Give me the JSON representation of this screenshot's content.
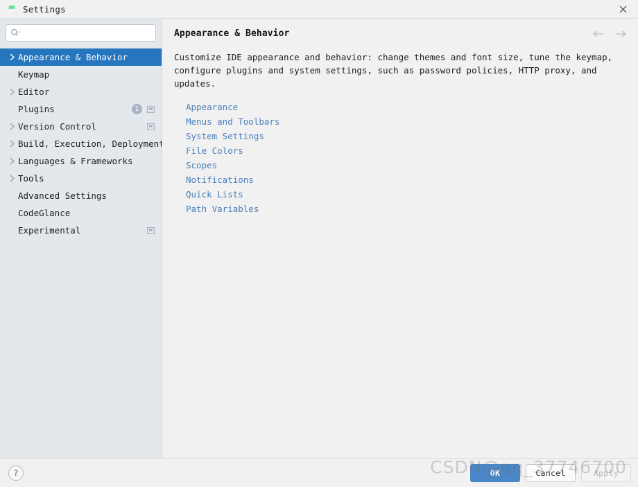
{
  "window": {
    "title": "Settings",
    "app_icon": "android-robot-icon",
    "close_icon": "close-icon"
  },
  "search": {
    "value": "",
    "placeholder": "",
    "icon": "search-icon"
  },
  "sidebar": {
    "items": [
      {
        "label": "Appearance & Behavior",
        "expandable": true,
        "selected": true,
        "badge": null,
        "panel_icon": false
      },
      {
        "label": "Keymap",
        "expandable": false,
        "selected": false,
        "badge": null,
        "panel_icon": false
      },
      {
        "label": "Editor",
        "expandable": true,
        "selected": false,
        "badge": null,
        "panel_icon": false
      },
      {
        "label": "Plugins",
        "expandable": false,
        "selected": false,
        "badge": "1",
        "panel_icon": true
      },
      {
        "label": "Version Control",
        "expandable": true,
        "selected": false,
        "badge": null,
        "panel_icon": true
      },
      {
        "label": "Build, Execution, Deployment",
        "expandable": true,
        "selected": false,
        "badge": null,
        "panel_icon": false
      },
      {
        "label": "Languages & Frameworks",
        "expandable": true,
        "selected": false,
        "badge": null,
        "panel_icon": false
      },
      {
        "label": "Tools",
        "expandable": true,
        "selected": false,
        "badge": null,
        "panel_icon": false
      },
      {
        "label": "Advanced Settings",
        "expandable": false,
        "selected": false,
        "badge": null,
        "panel_icon": false
      },
      {
        "label": "CodeGlance",
        "expandable": false,
        "selected": false,
        "badge": null,
        "panel_icon": false
      },
      {
        "label": "Experimental",
        "expandable": false,
        "selected": false,
        "badge": null,
        "panel_icon": true
      }
    ]
  },
  "main": {
    "title": "Appearance & Behavior",
    "description": "Customize IDE appearance and behavior: change themes and font size, tune the keymap,\nconfigure plugins and system settings, such as password policies, HTTP proxy, and updates.",
    "back_icon": "arrow-left-icon",
    "forward_icon": "arrow-right-icon",
    "links": [
      "Appearance",
      "Menus and Toolbars",
      "System Settings",
      "File Colors",
      "Scopes",
      "Notifications",
      "Quick Lists",
      "Path Variables"
    ]
  },
  "footer": {
    "help_label": "?",
    "ok_label": "OK",
    "cancel_label": "Cancel",
    "apply_label": "Apply"
  },
  "watermark": {
    "text": "CSDN@qq_37746700"
  },
  "colors": {
    "accent": "#4a87c8",
    "selection": "#2675bf",
    "link": "#4a7ebb",
    "sidebar_bg": "#e3e8ed",
    "content_bg": "#f1f1f1",
    "badge_bg": "#a7b4c1"
  }
}
